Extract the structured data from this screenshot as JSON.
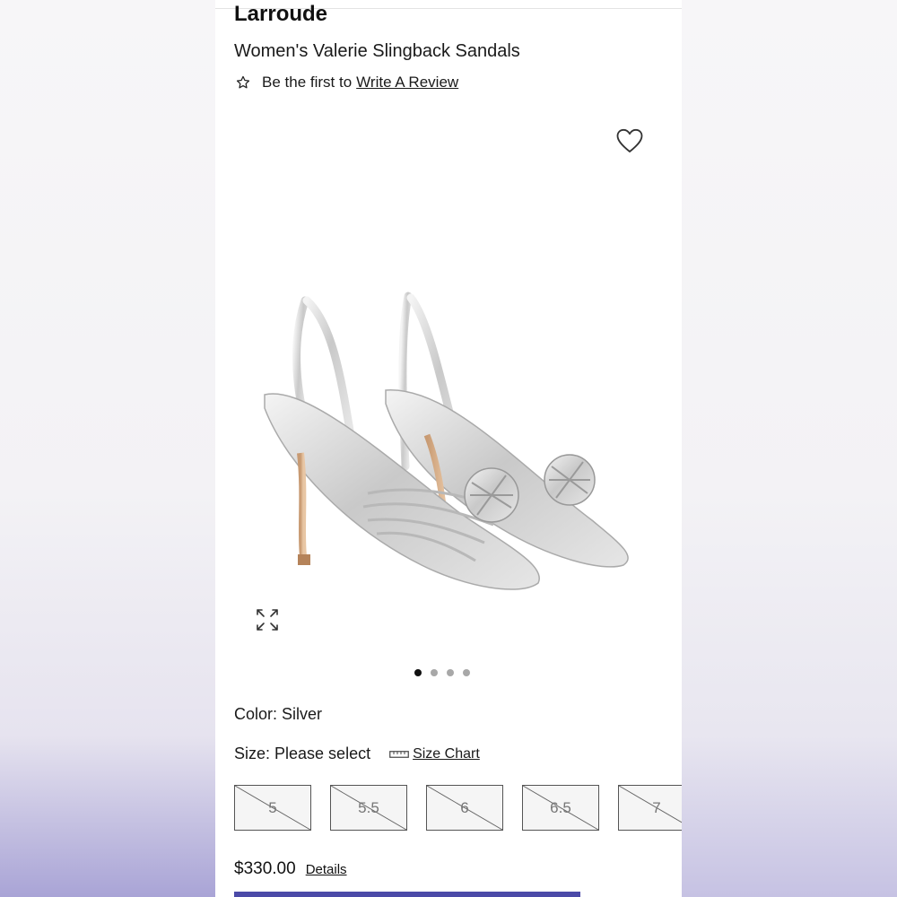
{
  "product": {
    "brand": "Larroude",
    "title": "Women's Valerie Slingback Sandals"
  },
  "reviews": {
    "prompt": "Be the first to",
    "link_label": "Write A Review"
  },
  "icons": {
    "favorite": "heart-outline-icon",
    "review": "star-outline-icon",
    "expand": "expand-arrows-icon",
    "size_chart": "ruler-icon"
  },
  "gallery": {
    "image_count": 4,
    "active_index": 0
  },
  "options": {
    "color_text": "Color: Silver",
    "size_text": "Size: Please select",
    "size_chart_label": "Size Chart",
    "sizes": [
      "5",
      "5.5",
      "6",
      "6.5",
      "7"
    ],
    "sizes_unavailable": true
  },
  "pricing": {
    "price": "$330.00",
    "details_label": "Details"
  },
  "colors": {
    "accent": "#4b4aa8",
    "text": "#1a1a1a"
  }
}
